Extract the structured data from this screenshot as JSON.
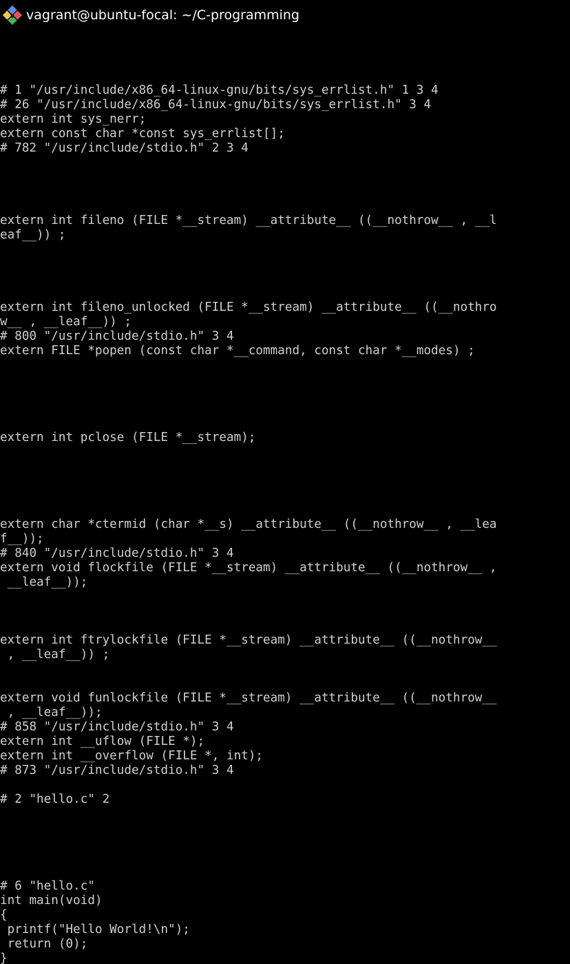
{
  "window": {
    "title": "vagrant@ubuntu-focal: ~/C-programming",
    "icon": "vagrant-diamond-icon",
    "background_color": "#000000",
    "text_color": "#d0d0d0",
    "title_color": "#ffffff"
  },
  "terminal": {
    "columns": 76,
    "rows": 64,
    "font_size_px": 17.6,
    "line_height_px": 21,
    "lines": [
      "# 1 \"/usr/include/x86_64-linux-gnu/bits/sys_errlist.h\" 1 3 4",
      "# 26 \"/usr/include/x86_64-linux-gnu/bits/sys_errlist.h\" 3 4",
      "extern int sys_nerr;",
      "extern const char *const sys_errlist[];",
      "# 782 \"/usr/include/stdio.h\" 2 3 4",
      "",
      "",
      "",
      "",
      "extern int fileno (FILE *__stream) __attribute__ ((__nothrow__ , __l",
      "eaf__)) ;",
      "",
      "",
      "",
      "",
      "extern int fileno_unlocked (FILE *__stream) __attribute__ ((__nothro",
      "w__ , __leaf__)) ;",
      "# 800 \"/usr/include/stdio.h\" 3 4",
      "extern FILE *popen (const char *__command, const char *__modes) ;",
      "",
      "",
      "",
      "",
      "",
      "extern int pclose (FILE *__stream);",
      "",
      "",
      "",
      "",
      "",
      "extern char *ctermid (char *__s) __attribute__ ((__nothrow__ , __lea",
      "f__));",
      "# 840 \"/usr/include/stdio.h\" 3 4",
      "extern void flockfile (FILE *__stream) __attribute__ ((__nothrow__ ,",
      " __leaf__));",
      "",
      "",
      "",
      "extern int ftrylockfile (FILE *__stream) __attribute__ ((__nothrow__",
      " , __leaf__)) ;",
      "",
      "",
      "extern void funlockfile (FILE *__stream) __attribute__ ((__nothrow__",
      " , __leaf__));",
      "# 858 \"/usr/include/stdio.h\" 3 4",
      "extern int __uflow (FILE *);",
      "extern int __overflow (FILE *, int);",
      "# 873 \"/usr/include/stdio.h\" 3 4",
      "",
      "# 2 \"hello.c\" 2",
      "",
      "",
      "",
      "",
      "",
      "# 6 \"hello.c\"",
      "int main(void)",
      "{",
      " printf(\"Hello World!\\n\");",
      " return (0);",
      "}"
    ]
  }
}
